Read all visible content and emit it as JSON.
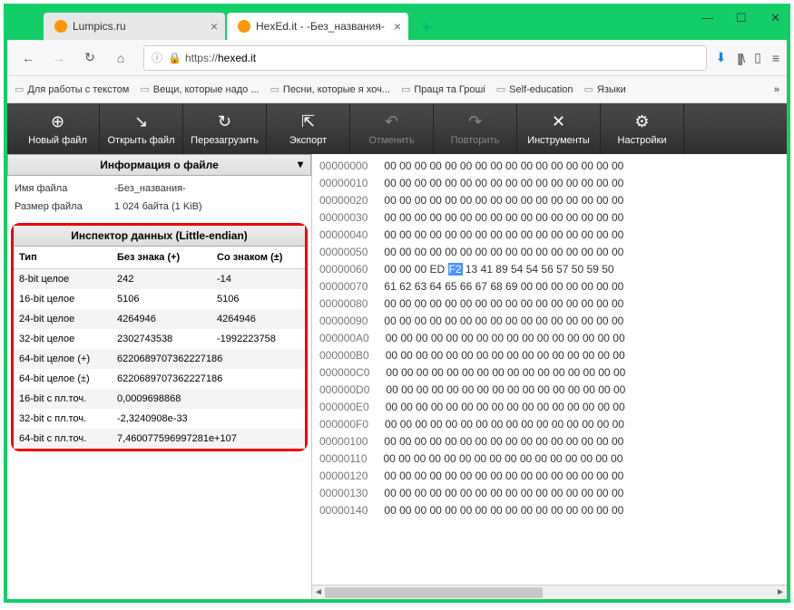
{
  "tabs": [
    {
      "title": "Lumpics.ru",
      "active": false,
      "iconColor": "#f90"
    },
    {
      "title": "HexEd.it - -Без_названия-",
      "active": true,
      "iconColor": "#f90"
    }
  ],
  "url": {
    "prefix": "https://",
    "host": "hexed.it"
  },
  "bookmarks": [
    "Для работы с текстом",
    "Вещи, которые надо ...",
    "Песни, которые я хоч...",
    "Праця та Гроші",
    "Self-education",
    "Языки"
  ],
  "toolbar": [
    {
      "label": "Новый файл",
      "icon": "⊕",
      "enabled": true
    },
    {
      "label": "Открыть файл",
      "icon": "↘",
      "enabled": true
    },
    {
      "label": "Перезагрузить",
      "icon": "↻",
      "enabled": true
    },
    {
      "label": "Экспорт",
      "icon": "⇱",
      "enabled": true
    },
    {
      "label": "Отменить",
      "icon": "↶",
      "enabled": false
    },
    {
      "label": "Повторить",
      "icon": "↷",
      "enabled": false
    },
    {
      "label": "Инструменты",
      "icon": "✕",
      "enabled": true
    },
    {
      "label": "Настройки",
      "icon": "⚙",
      "enabled": true
    }
  ],
  "fileinfo": {
    "header": "Информация о файле",
    "rows": [
      {
        "label": "Имя файла",
        "value": "-Без_названия-"
      },
      {
        "label": "Размер файла",
        "value": "1 024 байта (1 KiB)"
      }
    ]
  },
  "inspector": {
    "header": "Инспектор данных (Little-endian)",
    "cols": [
      "Тип",
      "Без знака (+)",
      "Со знаком (±)"
    ],
    "rows": [
      {
        "type": "8-bit целое",
        "u": "242",
        "s": "-14"
      },
      {
        "type": "16-bit целое",
        "u": "5106",
        "s": "5106"
      },
      {
        "type": "24-bit целое",
        "u": "4264946",
        "s": "4264946"
      },
      {
        "type": "32-bit целое",
        "u": "2302743538",
        "s": "-1992223758"
      },
      {
        "type": "64-bit целое (+)",
        "u": "6220689707362227186",
        "s": ""
      },
      {
        "type": "64-bit целое (±)",
        "u": "6220689707362227186",
        "s": ""
      },
      {
        "type": "16-bit с пл.точ.",
        "u": "0,0009698868",
        "s": ""
      },
      {
        "type": "32-bit с пл.точ.",
        "u": "-2,3240908e-33",
        "s": ""
      },
      {
        "type": "64-bit с пл.точ.",
        "u": "7,460077596997281e+107",
        "s": ""
      }
    ]
  },
  "hex": {
    "selected": "F2",
    "rows": [
      {
        "addr": "00000000",
        "bytes": [
          "00",
          "00",
          "00",
          "00",
          "00",
          "00",
          "00",
          "00",
          "00",
          "00",
          "00",
          "00",
          "00",
          "00",
          "00",
          "00"
        ]
      },
      {
        "addr": "00000010",
        "bytes": [
          "00",
          "00",
          "00",
          "00",
          "00",
          "00",
          "00",
          "00",
          "00",
          "00",
          "00",
          "00",
          "00",
          "00",
          "00",
          "00"
        ]
      },
      {
        "addr": "00000020",
        "bytes": [
          "00",
          "00",
          "00",
          "00",
          "00",
          "00",
          "00",
          "00",
          "00",
          "00",
          "00",
          "00",
          "00",
          "00",
          "00",
          "00"
        ]
      },
      {
        "addr": "00000030",
        "bytes": [
          "00",
          "00",
          "00",
          "00",
          "00",
          "00",
          "00",
          "00",
          "00",
          "00",
          "00",
          "00",
          "00",
          "00",
          "00",
          "00"
        ]
      },
      {
        "addr": "00000040",
        "bytes": [
          "00",
          "00",
          "00",
          "00",
          "00",
          "00",
          "00",
          "00",
          "00",
          "00",
          "00",
          "00",
          "00",
          "00",
          "00",
          "00"
        ]
      },
      {
        "addr": "00000050",
        "bytes": [
          "00",
          "00",
          "00",
          "00",
          "00",
          "00",
          "00",
          "00",
          "00",
          "00",
          "00",
          "00",
          "00",
          "00",
          "00",
          "00"
        ]
      },
      {
        "addr": "00000060",
        "bytes": [
          "00",
          "00",
          "00",
          "ED",
          "F2",
          "13",
          "41",
          "89",
          "54",
          "54",
          "56",
          "57",
          "50",
          "59",
          "50"
        ]
      },
      {
        "addr": "00000070",
        "bytes": [
          "61",
          "62",
          "63",
          "64",
          "65",
          "66",
          "67",
          "68",
          "69",
          "00",
          "00",
          "00",
          "00",
          "00",
          "00",
          "00"
        ]
      },
      {
        "addr": "00000080",
        "bytes": [
          "00",
          "00",
          "00",
          "00",
          "00",
          "00",
          "00",
          "00",
          "00",
          "00",
          "00",
          "00",
          "00",
          "00",
          "00",
          "00"
        ]
      },
      {
        "addr": "00000090",
        "bytes": [
          "00",
          "00",
          "00",
          "00",
          "00",
          "00",
          "00",
          "00",
          "00",
          "00",
          "00",
          "00",
          "00",
          "00",
          "00",
          "00"
        ]
      },
      {
        "addr": "000000A0",
        "bytes": [
          "00",
          "00",
          "00",
          "00",
          "00",
          "00",
          "00",
          "00",
          "00",
          "00",
          "00",
          "00",
          "00",
          "00",
          "00",
          "00"
        ]
      },
      {
        "addr": "000000B0",
        "bytes": [
          "00",
          "00",
          "00",
          "00",
          "00",
          "00",
          "00",
          "00",
          "00",
          "00",
          "00",
          "00",
          "00",
          "00",
          "00",
          "00"
        ]
      },
      {
        "addr": "000000C0",
        "bytes": [
          "00",
          "00",
          "00",
          "00",
          "00",
          "00",
          "00",
          "00",
          "00",
          "00",
          "00",
          "00",
          "00",
          "00",
          "00",
          "00"
        ]
      },
      {
        "addr": "000000D0",
        "bytes": [
          "00",
          "00",
          "00",
          "00",
          "00",
          "00",
          "00",
          "00",
          "00",
          "00",
          "00",
          "00",
          "00",
          "00",
          "00",
          "00"
        ]
      },
      {
        "addr": "000000E0",
        "bytes": [
          "00",
          "00",
          "00",
          "00",
          "00",
          "00",
          "00",
          "00",
          "00",
          "00",
          "00",
          "00",
          "00",
          "00",
          "00",
          "00"
        ]
      },
      {
        "addr": "000000F0",
        "bytes": [
          "00",
          "00",
          "00",
          "00",
          "00",
          "00",
          "00",
          "00",
          "00",
          "00",
          "00",
          "00",
          "00",
          "00",
          "00",
          "00"
        ]
      },
      {
        "addr": "00000100",
        "bytes": [
          "00",
          "00",
          "00",
          "00",
          "00",
          "00",
          "00",
          "00",
          "00",
          "00",
          "00",
          "00",
          "00",
          "00",
          "00",
          "00"
        ]
      },
      {
        "addr": "00000110",
        "bytes": [
          "00",
          "00",
          "00",
          "00",
          "00",
          "00",
          "00",
          "00",
          "00",
          "00",
          "00",
          "00",
          "00",
          "00",
          "00",
          "00"
        ]
      },
      {
        "addr": "00000120",
        "bytes": [
          "00",
          "00",
          "00",
          "00",
          "00",
          "00",
          "00",
          "00",
          "00",
          "00",
          "00",
          "00",
          "00",
          "00",
          "00",
          "00"
        ]
      },
      {
        "addr": "00000130",
        "bytes": [
          "00",
          "00",
          "00",
          "00",
          "00",
          "00",
          "00",
          "00",
          "00",
          "00",
          "00",
          "00",
          "00",
          "00",
          "00",
          "00"
        ]
      },
      {
        "addr": "00000140",
        "bytes": [
          "00",
          "00",
          "00",
          "00",
          "00",
          "00",
          "00",
          "00",
          "00",
          "00",
          "00",
          "00",
          "00",
          "00",
          "00",
          "00"
        ]
      }
    ],
    "selRow": 6,
    "selCol": 4
  }
}
